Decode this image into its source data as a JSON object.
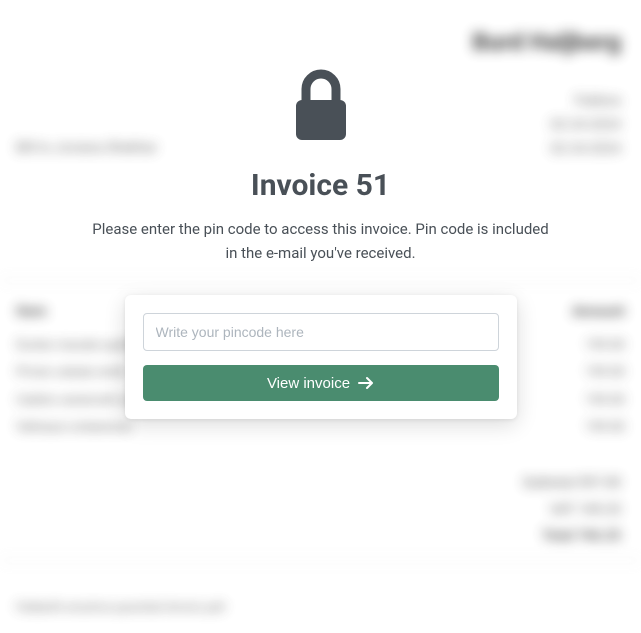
{
  "title": "Invoice 51",
  "subtitle": "Please enter the pin code to access this invoice. Pin code is included in the e-mail you've received.",
  "input": {
    "placeholder": "Write your pincode here",
    "value": ""
  },
  "button": {
    "label": "View invoice"
  },
  "colors": {
    "accent": "#4a8c6f",
    "text": "#495057"
  }
}
